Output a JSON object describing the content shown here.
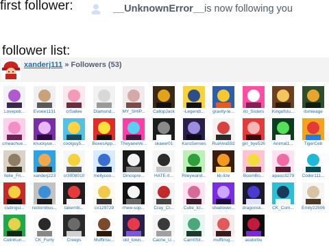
{
  "header": {
    "first_label": "first follower:",
    "notice_user": "__UnknownError__",
    "notice_text": " is now following you"
  },
  "list": {
    "label": "follower list:",
    "owner": "xanderj111",
    "separator": "»",
    "title": "Followers (53)"
  },
  "followers": [
    {
      "name": "Lovepoti...",
      "c1": "#f4f0f7",
      "c2": "#b05ad0",
      "c3": "#3a2a4a"
    },
    {
      "name": "Evoee1131",
      "c1": "#f0f0f0",
      "c2": "#c9a27b",
      "c3": "#5a5a5a"
    },
    {
      "name": "crSailee",
      "c1": "#fde8ef",
      "c2": "#f39ab6",
      "c3": "#6a2f3e"
    },
    {
      "name": "Diamond...",
      "c1": "#f2f2f2",
      "c2": "#d8d8d8",
      "c3": "#9a9a9a"
    },
    {
      "name": "MY_SHIP...",
      "c1": "#f0eaea",
      "c2": "#d6a9a9",
      "c3": "#7a4c4c"
    },
    {
      "name": "CallopJack",
      "c1": "#3b2a14",
      "c2": "#e3a21a",
      "c3": "#111111"
    },
    {
      "name": "-Legendl...",
      "c1": "#f7d23b",
      "c2": "#2b4f8a",
      "c3": "#101010"
    },
    {
      "name": "gravity-le...",
      "c1": "#2d5fa8",
      "c2": "#f6c72e",
      "c3": "#e35b2a"
    },
    {
      "name": "ito_Sisters",
      "c1": "#ff4fa3",
      "c2": "#ffffff",
      "c3": "#8a1e58"
    },
    {
      "name": "Kingofstu...",
      "c1": "#6d4020",
      "c2": "#f4c55a",
      "c3": "#2c1a0c"
    },
    {
      "name": "itsmieage",
      "c1": "#2e4d2b",
      "c2": "#e8a52c",
      "c3": "#0f1f14"
    },
    {
      "name": "cmeachue...",
      "c1": "#ffd0ea",
      "c2": "#f28fc7",
      "c3": "#6b2355"
    },
    {
      "name": "knuckyue...",
      "c1": "#7a2ea8",
      "c2": "#e8b8f5",
      "c3": "#2a0c3c"
    },
    {
      "name": "coolguy5...",
      "c1": "#4fc2e6",
      "c2": "#ffd342",
      "c3": "#16485a"
    },
    {
      "name": "BoxesApp...",
      "c1": "#e22b2b",
      "c2": "#f7e23b",
      "c3": "#111111"
    },
    {
      "name": "TheyaneVe...",
      "c1": "#ff3fa6",
      "c2": "#55d1f1",
      "c3": "#3a1a3a"
    },
    {
      "name": "skaeer01",
      "c1": "#1d1d1d",
      "c2": "#8a8a8a",
      "c3": "#ffffff"
    },
    {
      "name": "KuroSenses",
      "c1": "#2a1f4a",
      "c2": "#9b8de0",
      "c3": "#0c0a1a"
    },
    {
      "name": "RuiAlva592",
      "c1": "#f7f0f0",
      "c2": "#d94040",
      "c3": "#2a2a2a"
    },
    {
      "name": "girl_bye526",
      "c1": "#e33b3b",
      "c2": "#f7b6b6",
      "c3": "#3a0c0c"
    },
    {
      "name": "Animal1...",
      "c1": "#0d3d1e",
      "c2": "#55e05a",
      "c3": "#f5f5f5"
    },
    {
      "name": "TigerCeb",
      "c1": "#f3a31f",
      "c2": "#e53a3a",
      "c3": "#2a7ae0"
    },
    {
      "name": "lIelie_Fri...",
      "c1": "#d9d2c6",
      "c2": "#8e7c63",
      "c3": "#3a3024"
    },
    {
      "name": "xanderj223",
      "c1": "#2ea2e6",
      "c2": "#f0a84a",
      "c3": "#3a2210"
    },
    {
      "name": "cr3008010",
      "c1": "#f6f6f6",
      "c2": "#f3d33c",
      "c3": "#555555"
    },
    {
      "name": "mellycoo...",
      "c1": "#d7ecff",
      "c2": "#3a6fd1",
      "c3": "#0c1e44"
    },
    {
      "name": "Dinospre...",
      "c1": "#1a1a1a",
      "c2": "#f3f3f3",
      "c3": "#777777"
    },
    {
      "name": "HATE-II...",
      "c1": "#f5f5f5",
      "c2": "#2c2c2c",
      "c3": "#c9c9c9"
    },
    {
      "name": "Rileywand...",
      "c1": "#bdf0b6",
      "c2": "#2f9f3c",
      "c3": "#0c3012"
    },
    {
      "name": "kk-lize",
      "c1": "#3a1d0c",
      "c2": "#f29a1f",
      "c3": "#ffd86a"
    },
    {
      "name": "BoomBo...",
      "c1": "#ffc4cf",
      "c2": "#f3dc3b",
      "c3": "#6a2f3e"
    },
    {
      "name": "apaso3279",
      "c1": "#ffe1ef",
      "c2": "#f06aa5",
      "c3": "#5a1a34"
    },
    {
      "name": "Coder111...",
      "c1": "#ffffff",
      "c2": "#1fb8d6",
      "c3": "#0a4a5a"
    },
    {
      "name": "csdingsl...",
      "c1": "#c42a2a",
      "c2": "#f5d042",
      "c3": "#101010"
    },
    {
      "name": "rectornbus...",
      "c1": "#c2c2c2",
      "c2": "#3b8fd6",
      "c3": "#1a1a1a"
    },
    {
      "name": "takembl...",
      "c1": "#1f1f1f",
      "c2": "#e63a3a",
      "c3": "#f3f3f3"
    },
    {
      "name": "cx129729",
      "c1": "#fdfaf0",
      "c2": "#f3c94a",
      "c3": "#333333"
    },
    {
      "name": "rhew-sop...",
      "c1": "#111111",
      "c2": "#f5f5f5",
      "c3": "#666666"
    },
    {
      "name": "Cray_Cr...",
      "c1": "#f4f4f4",
      "c2": "#c22a2a",
      "c3": "#444444"
    },
    {
      "name": "Cutie_lcl...",
      "c1": "#ffe0f0",
      "c2": "#d86a9a",
      "c3": "#3a1a2a"
    },
    {
      "name": "shadower...",
      "c1": "#7a2ce0",
      "c2": "#c9a7ff",
      "c3": "#1a0c3a"
    },
    {
      "name": "dragonsk...",
      "c1": "#1a1a2a",
      "c2": "#4a3ad1",
      "c3": "#e0e0ff"
    },
    {
      "name": "CK_Com...",
      "c1": "#2ac0d6",
      "c2": "#1a3a5a",
      "c3": "#f5f5f5"
    },
    {
      "name": "Emily22506",
      "c1": "#f5f5f5",
      "c2": "#d9c3a5",
      "c3": "#4a3a2a"
    },
    {
      "name": "ColinKun...",
      "c1": "#22a84a",
      "c2": "#e6d34a",
      "c3": "#0c2a14"
    },
    {
      "name": "CK_Furry",
      "c1": "#fafafa",
      "c2": "#2a2a2a",
      "c3": "#888888"
    },
    {
      "name": "Creeps",
      "c1": "#2a2a2a",
      "c2": "#6a6a6a",
      "c3": "#d0d0d0"
    },
    {
      "name": "Muffinsu...",
      "c1": "#ffffff",
      "c2": "#7a4a2a",
      "c3": "#2a1a0c"
    },
    {
      "name": "old_town...",
      "c1": "#2a1f4a",
      "c2": "#e63a4a",
      "c3": "#7a5ad9"
    },
    {
      "name": "Cache_U...",
      "c1": "#f5f5f5",
      "c2": "#3a3a3a",
      "c3": "#a0a0a0"
    },
    {
      "name": "Cam0Sil...",
      "c1": "#e6f7f0",
      "c2": "#4aa87a",
      "c3": "#1a3a2a"
    },
    {
      "name": "muffinsg...",
      "c1": "#f5eaea",
      "c2": "#e05a5a",
      "c3": "#3a1a1a"
    },
    {
      "name": "asidorbu",
      "c1": "#0d0d0d",
      "c2": "#c21a3a",
      "c3": "#7a2ad1"
    }
  ]
}
